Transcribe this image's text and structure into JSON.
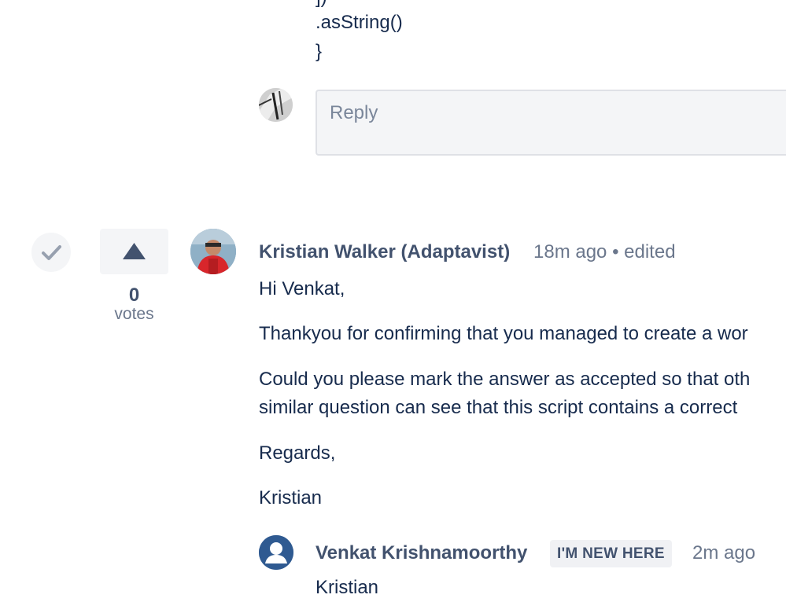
{
  "code": {
    "line_bracket": "])",
    "line_asstring": ".asString()",
    "line_close": "}"
  },
  "reply": {
    "placeholder": "Reply"
  },
  "answer": {
    "votes_count": "0",
    "votes_label": "votes",
    "author": "Kristian Walker (Adaptavist)",
    "time": "18m ago",
    "separator": "•",
    "edited": "edited",
    "paragraphs": [
      "Hi Venkat,",
      "Thankyou for confirming that you managed to create a wor",
      "Could you please mark the answer as accepted so that oth",
      "similar question can see that this script contains a correct",
      "Regards,",
      "Kristian"
    ]
  },
  "nested_reply": {
    "author": "Venkat Krishnamoorthy",
    "badge": "I'M NEW HERE",
    "time": "2m ago",
    "preview": "Kristian"
  },
  "colors": {
    "accent": "#42526e",
    "muted": "#6b778c",
    "surface": "#f4f5f7"
  },
  "icons": {
    "accept": "check-icon",
    "upvote": "triangle-up-icon",
    "user_default": "user-silhouette-icon"
  }
}
